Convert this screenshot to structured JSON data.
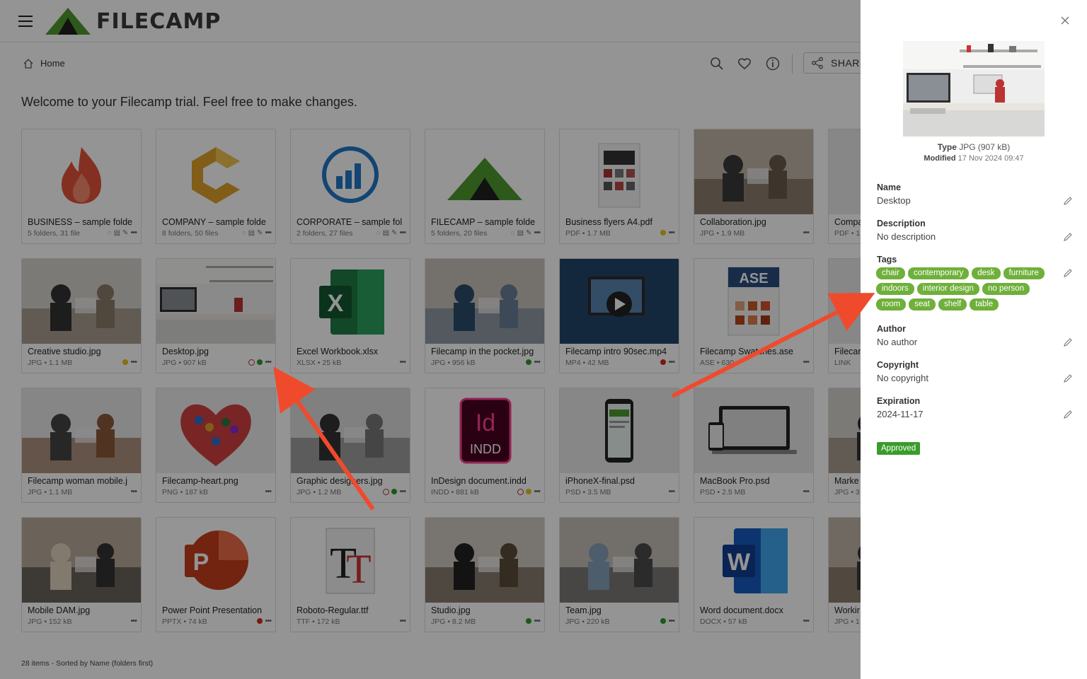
{
  "app": {
    "logo_text": "FILECAMP"
  },
  "breadcrumb": {
    "home": "Home"
  },
  "toolbar": {
    "share_label": "SHARE"
  },
  "welcome": "Welcome to your Filecamp trial. Feel free to make changes.",
  "items": [
    {
      "name": "BUSINESS – sample folde",
      "meta": "5 folders, 31 file",
      "thumb": "fire-logo"
    },
    {
      "name": "COMPANY – sample folde",
      "meta": "8 folders, 50 files",
      "thumb": "c-logo"
    },
    {
      "name": "CORPORATE – sample fol",
      "meta": "2 folders, 27 files",
      "thumb": "chart-logo"
    },
    {
      "name": "FILECAMP – sample folde",
      "meta": "5 folders, 20 files",
      "thumb": "filecamp-logo"
    },
    {
      "name": "Business flyers A4.pdf",
      "meta": "PDF • 1.7 MB",
      "thumb": "flyer-photo"
    },
    {
      "name": "Collaboration.jpg",
      "meta": "JPG • 1.9 MB",
      "thumb": "people-photo"
    },
    {
      "name": "Compa",
      "meta": "PDF • 1",
      "thumb": "blank"
    },
    {
      "name": "Creative studio.jpg",
      "meta": "JPG • 1.1 MB",
      "thumb": "office-photo"
    },
    {
      "name": "Desktop.jpg",
      "meta": "JPG • 907 kB",
      "thumb": "desk-photo"
    },
    {
      "name": "Excel Workbook.xlsx",
      "meta": "XLSX • 25 kB",
      "thumb": "excel-logo"
    },
    {
      "name": "Filecamp in the pocket.jpg",
      "meta": "JPG • 956 kB",
      "thumb": "pocket-photo"
    },
    {
      "name": "Filecamp intro 90sec.mp4",
      "meta": "MP4 • 42 MB",
      "thumb": "video-photo"
    },
    {
      "name": "Filecamp Swatches.ase",
      "meta": "ASE • 630",
      "thumb": "ase-logo"
    },
    {
      "name": "Filecar",
      "meta": "LINK",
      "thumb": "blank"
    },
    {
      "name": "Filecamp woman mobile.j",
      "meta": "JPG • 1.1 MB",
      "thumb": "woman-photo"
    },
    {
      "name": "Filecamp-heart.png",
      "meta": "PNG • 187 kB",
      "thumb": "heart-logo"
    },
    {
      "name": "Graphic designers.jpg",
      "meta": "JPG • 1.2 MB",
      "thumb": "designers-photo"
    },
    {
      "name": "InDesign document.indd",
      "meta": "INDD • 881 kB",
      "thumb": "indd-logo"
    },
    {
      "name": "iPhoneX-final.psd",
      "meta": "PSD • 3.5 MB",
      "thumb": "phone-logo"
    },
    {
      "name": "MacBook Pro.psd",
      "meta": "PSD • 2.5 MB",
      "thumb": "macbook-logo"
    },
    {
      "name": "Marke",
      "meta": "JPG • 3",
      "thumb": "office-photo"
    },
    {
      "name": "Mobile DAM.jpg",
      "meta": "JPG • 152 kB",
      "thumb": "mobile-photo"
    },
    {
      "name": "Power Point Presentation",
      "meta": "PPTX • 74 kB",
      "thumb": "ppt-logo"
    },
    {
      "name": "Roboto-Regular.ttf",
      "meta": "TTF • 172 kB",
      "thumb": "font-logo"
    },
    {
      "name": "Studio.jpg",
      "meta": "JPG • 8.2 MB",
      "thumb": "studio-photo"
    },
    {
      "name": "Team.jpg",
      "meta": "JPG • 220 kB",
      "thumb": "team-photo"
    },
    {
      "name": "Word document.docx",
      "meta": "DOCX • 57 kB",
      "thumb": "word-logo"
    },
    {
      "name": "Workir",
      "meta": "JPG • 1",
      "thumb": "people-photo"
    }
  ],
  "status_line": "28 items - Sorted by Name (folders first)",
  "panel": {
    "type_label": "Type",
    "type_value": "JPG (907 kB)",
    "modified_label": "Modified",
    "modified_value": "17 Nov 2024 09:47",
    "name_label": "Name",
    "name_value": "Desktop",
    "description_label": "Description",
    "description_value": "No description",
    "tags_label": "Tags",
    "tags": [
      "chair",
      "contemporary",
      "desk",
      "furniture",
      "indoors",
      "interior design",
      "no person",
      "room",
      "seat",
      "shelf",
      "table"
    ],
    "author_label": "Author",
    "author_value": "No author",
    "copyright_label": "Copyright",
    "copyright_value": "No copyright",
    "expiration_label": "Expiration",
    "expiration_value": "2024-11-17",
    "status_badge": "Approved"
  },
  "colors": {
    "tag_green": "#6fb03b",
    "approved_green": "#3a9c2b",
    "arrow_red": "#f04a2c"
  }
}
